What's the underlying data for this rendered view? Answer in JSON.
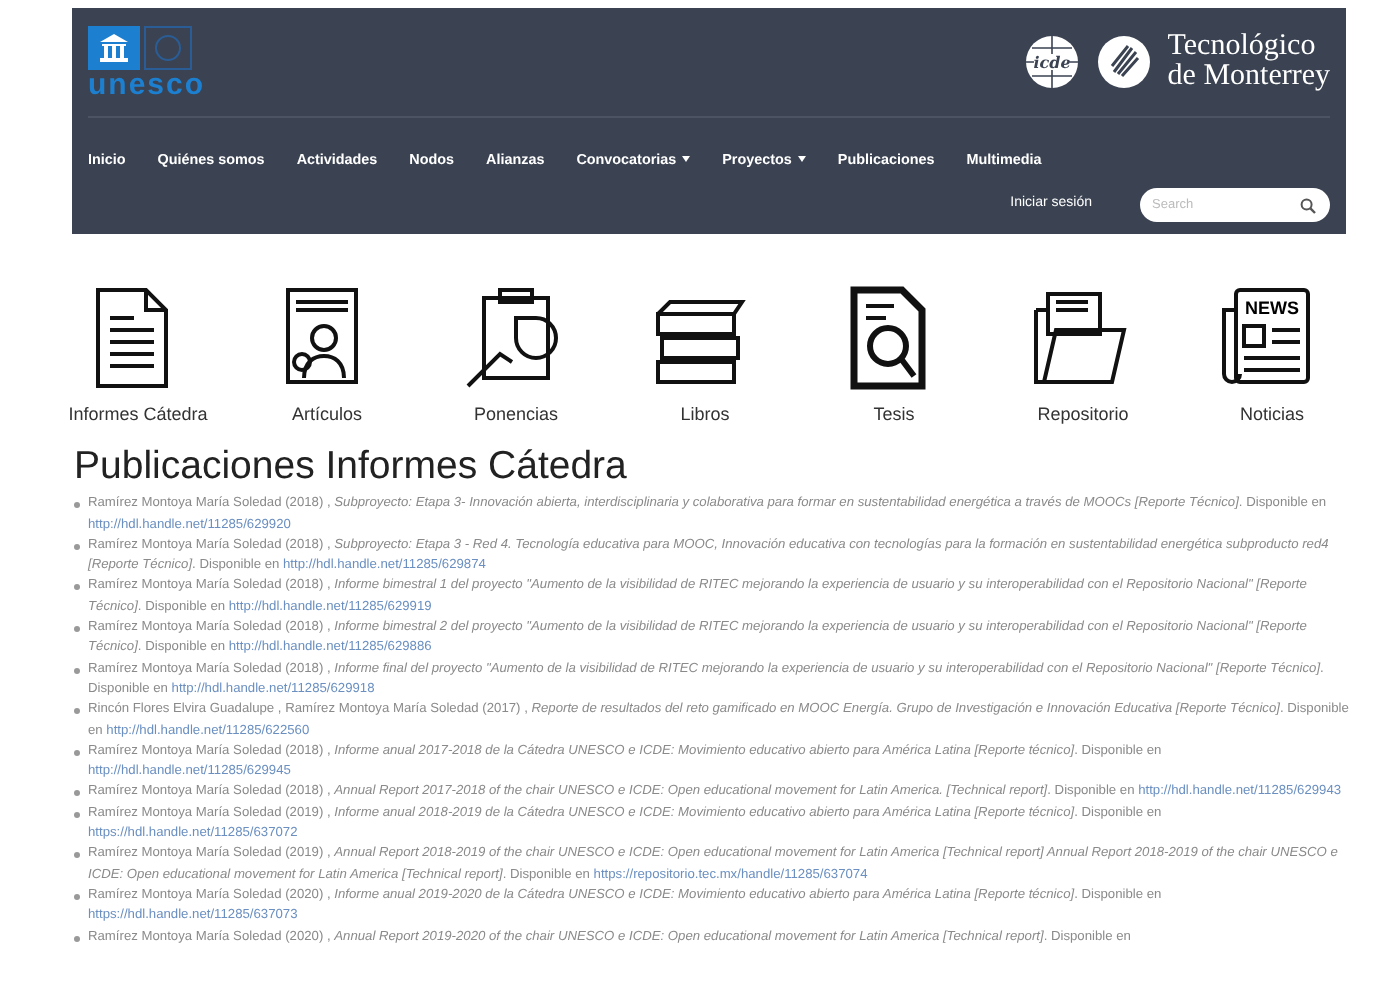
{
  "header": {
    "unesco_logo": "unesco",
    "icde_logo": "icde",
    "tec_logo": [
      "Tecnológico",
      "de Monterrey"
    ]
  },
  "nav": [
    {
      "label": "Inicio",
      "has_menu": false
    },
    {
      "label": "Quiénes somos",
      "has_menu": false
    },
    {
      "label": "Actividades",
      "has_menu": false
    },
    {
      "label": "Nodos",
      "has_menu": false
    },
    {
      "label": "Alianzas",
      "has_menu": false
    },
    {
      "label": "Convocatorias",
      "has_menu": true
    },
    {
      "label": "Proyectos",
      "has_menu": true
    },
    {
      "label": "Publicaciones",
      "has_menu": false
    },
    {
      "label": "Multimedia",
      "has_menu": false
    }
  ],
  "login": "Iniciar sesión",
  "search": {
    "placeholder": "Search"
  },
  "categories": [
    {
      "label": "Informes Cátedra"
    },
    {
      "label": "Artículos"
    },
    {
      "label": "Ponencias"
    },
    {
      "label": "Libros"
    },
    {
      "label": "Tesis"
    },
    {
      "label": "Repositorio"
    },
    {
      "label": "Noticias",
      "icon_text": "NEWS"
    }
  ],
  "heading": "Publicaciones Informes Cátedra",
  "publications": [
    {
      "text": "Ramírez Montoya María Soledad (2018) , *Subproyecto: Etapa 3- Innovación abierta, interdisciplinaria y colaborativa para formar en sustentabilidad energética a través de MOOCs [Reporte Técnico]*. Disponible en",
      "link": "http://hdl.handle.net/11285/629920"
    },
    {
      "text": "Ramírez Montoya María Soledad (2018) , *Subproyecto: Etapa 3 - Red 4. Tecnología educativa para MOOC, Innovación educativa con tecnologías para la formación en sustentabilidad energética subproducto red4 [Reporte Técnico]*. Disponible en",
      "link": "http://hdl.handle.net/11285/629874"
    },
    {
      "text": "Ramírez Montoya María Soledad (2018) , *Informe bimestral 1 del proyecto \"Aumento de la visibilidad de RITEC mejorando la experiencia de usuario y su interoperabilidad con el Repositorio Nacional\" [Reporte Técnico]*. Disponible en",
      "link": "http://hdl.handle.net/11285/629919"
    },
    {
      "text": "Ramírez Montoya María Soledad (2018) , *Informe bimestral 2 del proyecto \"Aumento de la visibilidad de RITEC mejorando la experiencia de usuario y su interoperabilidad con el Repositorio Nacional\" [Reporte Técnico]*. Disponible en",
      "link": "http://hdl.handle.net/11285/629886"
    },
    {
      "text": "Ramírez Montoya María Soledad (2018) , *Informe final del proyecto \"Aumento de la visibilidad de RITEC mejorando la experiencia de usuario y su interoperabilidad con el Repositorio Nacional\" [Reporte Técnico]*. Disponible en",
      "link": "http://hdl.handle.net/11285/629918"
    },
    {
      "text": "Rincón Flores Elvira Guadalupe , Ramírez Montoya María Soledad (2017) , *Reporte de resultados del reto gamificado en MOOC Energía. Grupo de Investigación e Innovación Educativa [Reporte Técnico]*. Disponible en",
      "link": "http://hdl.handle.net/11285/622560"
    },
    {
      "text": "Ramírez Montoya María Soledad (2018) , *Informe anual 2017-2018 de la Cátedra UNESCO e ICDE: Movimiento educativo abierto para América Latina [Reporte técnico]*. Disponible en",
      "link": "http://hdl.handle.net/11285/629945"
    },
    {
      "text": "Ramírez Montoya María Soledad (2018) , *Annual Report 2017-2018 of the chair UNESCO e ICDE: Open educational movement for Latin America. [Technical report]*. Disponible en",
      "link": "http://hdl.handle.net/11285/629943"
    },
    {
      "text": "Ramírez Montoya María Soledad (2019) , *Informe anual 2018-2019 de la Cátedra UNESCO e ICDE: Movimiento educativo abierto para América Latina [Reporte técnico]*. Disponible en",
      "link": "https://hdl.handle.net/11285/637072"
    },
    {
      "text": "Ramírez Montoya María Soledad (2019) , *Annual Report 2018-2019 of the chair UNESCO e ICDE: Open educational movement for Latin America [Technical report] Annual Report 2018-2019 of the chair UNESCO e ICDE: Open educational movement for Latin America [Technical report]*. Disponible en",
      "link": "https://repositorio.tec.mx/handle/11285/637074"
    },
    {
      "text": "Ramírez Montoya María Soledad (2020) , *Informe anual 2019-2020 de la Cátedra UNESCO e ICDE: Movimiento educativo abierto para América Latina [Reporte técnico]*. Disponible en",
      "link": "https://hdl.handle.net/11285/637073"
    },
    {
      "text": "Ramírez Montoya María Soledad (2020) , *Annual Report 2019-2020 of the chair UNESCO e ICDE: Open educational movement for Latin America [Technical report]*. Disponible en"
    }
  ]
}
